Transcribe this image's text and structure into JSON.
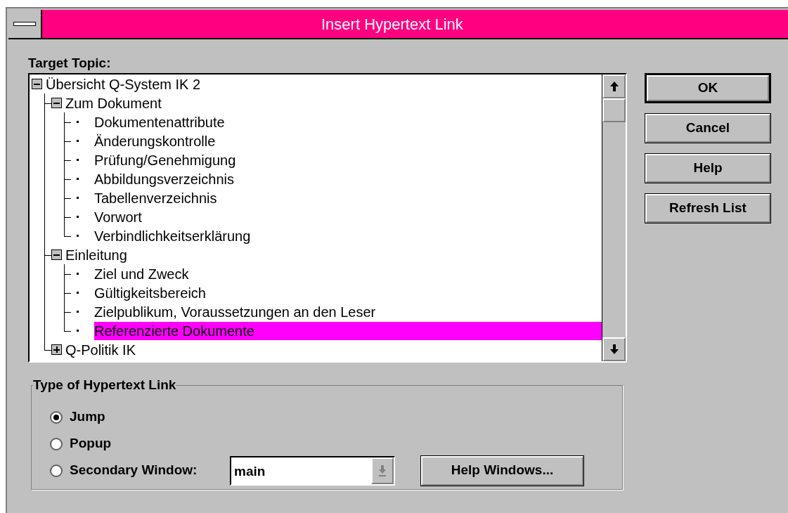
{
  "window": {
    "title": "Insert Hypertext Link"
  },
  "target_topic": {
    "label": "Target Topic:"
  },
  "tree": [
    {
      "label": "Übersicht Q-System IK 2",
      "expanded": true,
      "selected": false,
      "children": [
        {
          "label": "Zum Dokument",
          "expanded": true,
          "selected": false,
          "children": [
            {
              "label": "Dokumentenattribute",
              "selected": false
            },
            {
              "label": "Änderungskontrolle",
              "selected": false
            },
            {
              "label": "Prüfung/Genehmigung",
              "selected": false
            },
            {
              "label": "Abbildungsverzeichnis",
              "selected": false
            },
            {
              "label": "Tabellenverzeichnis",
              "selected": false
            },
            {
              "label": "Vorwort",
              "selected": false
            },
            {
              "label": "Verbindlichkeitserklärung",
              "selected": false
            }
          ]
        },
        {
          "label": "Einleitung",
          "expanded": true,
          "selected": false,
          "children": [
            {
              "label": "Ziel und Zweck",
              "selected": false
            },
            {
              "label": "Gültigkeitsbereich",
              "selected": false
            },
            {
              "label": "Zielpublikum, Voraussetzungen an den Leser",
              "selected": false
            },
            {
              "label": "Referenzierte Dokumente",
              "selected": true
            }
          ]
        },
        {
          "label": "Q-Politik IK",
          "expanded": false,
          "selected": false
        }
      ]
    }
  ],
  "buttons": [
    {
      "label": "OK",
      "default": true
    },
    {
      "label": "Cancel",
      "default": false
    },
    {
      "label": "Help",
      "default": false
    },
    {
      "label": "Refresh List",
      "default": false
    }
  ],
  "link_type": {
    "label": "Type of Hypertext Link",
    "options": [
      {
        "label": "Jump",
        "selected": true
      },
      {
        "label": "Popup",
        "selected": false
      },
      {
        "label": "Secondary Window:",
        "selected": false
      }
    ]
  },
  "secondary_window": {
    "value": "main"
  },
  "help_windows_button": {
    "label": "Help Windows..."
  }
}
